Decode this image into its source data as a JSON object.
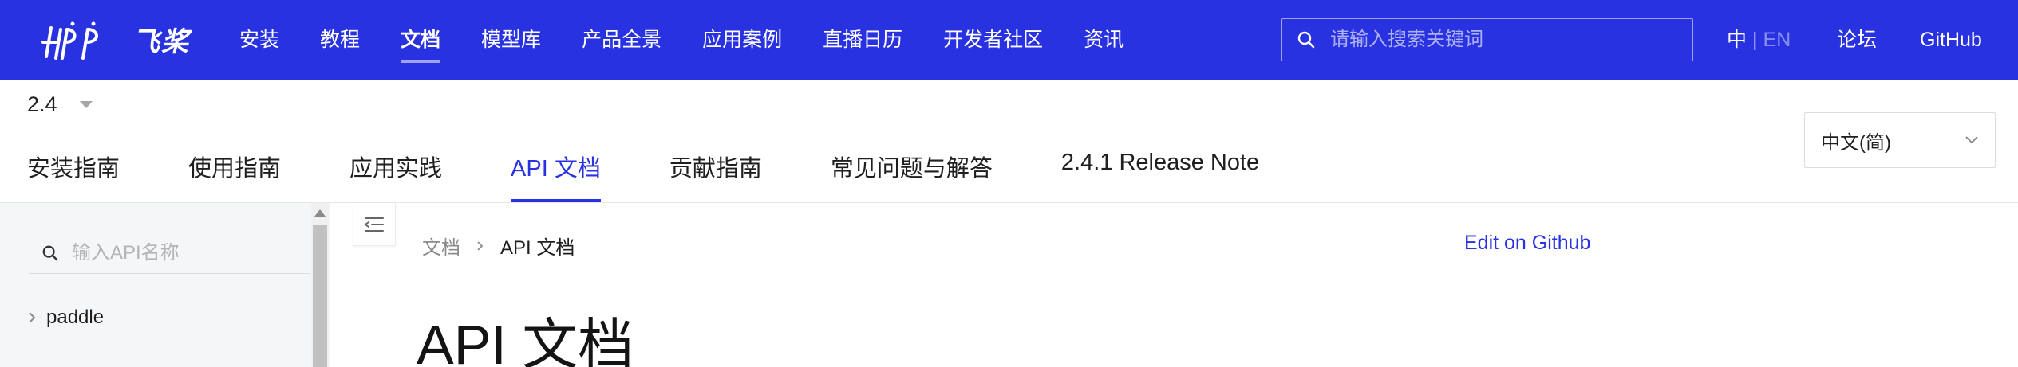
{
  "brand": {
    "logo_text": "飞桨"
  },
  "topnav": {
    "items": [
      {
        "label": "安装"
      },
      {
        "label": "教程"
      },
      {
        "label": "文档"
      },
      {
        "label": "模型库"
      },
      {
        "label": "产品全景"
      },
      {
        "label": "应用案例"
      },
      {
        "label": "直播日历"
      },
      {
        "label": "开发者社区"
      },
      {
        "label": "资讯"
      }
    ],
    "active_index": 2,
    "search_placeholder": "请输入搜索关键词",
    "lang_zh": "中",
    "lang_sep": "|",
    "lang_en": "EN",
    "forum": "论坛",
    "github": "GitHub"
  },
  "version": {
    "value": "2.4"
  },
  "subtabs": {
    "items": [
      {
        "label": "安装指南"
      },
      {
        "label": "使用指南"
      },
      {
        "label": "应用实践"
      },
      {
        "label": "API 文档"
      },
      {
        "label": "贡献指南"
      },
      {
        "label": "常见问题与解答"
      },
      {
        "label": "2.4.1 Release Note"
      }
    ],
    "active_index": 3
  },
  "language_select": {
    "value": "中文(简)"
  },
  "sidebar": {
    "search_placeholder": "输入API名称",
    "tree": [
      {
        "label": "paddle"
      }
    ]
  },
  "content": {
    "breadcrumb": [
      "文档",
      "API 文档"
    ],
    "edit_link": "Edit on Github",
    "title": "API 文档"
  },
  "colors": {
    "brand": "#2932e1",
    "sidebar_bg": "#f5f6f8"
  },
  "icons": [
    "paddle-logo-icon",
    "search-icon",
    "chevron-down-icon",
    "chevron-right-icon",
    "toc-collapse-icon"
  ]
}
